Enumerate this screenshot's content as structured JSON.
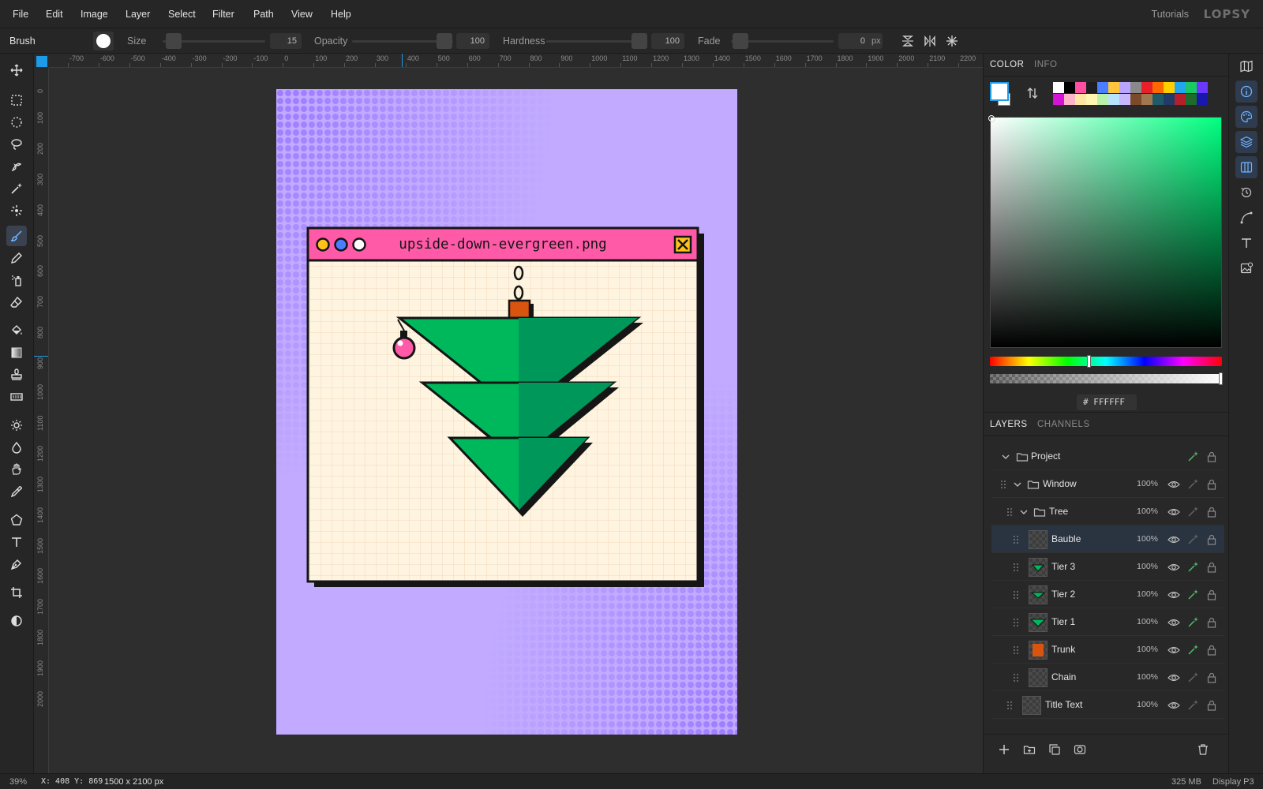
{
  "menu": [
    "File",
    "Edit",
    "Image",
    "Layer",
    "Select",
    "Filter",
    "Path",
    "View",
    "Help"
  ],
  "header_right": {
    "tutorials": "Tutorials",
    "logo": "LOPSY"
  },
  "options": {
    "tool_name": "Brush",
    "size_label": "Size",
    "size_value": "15",
    "opacity_label": "Opacity",
    "opacity_value": "100",
    "hardness_label": "Hardness",
    "hardness_value": "100",
    "fade_label": "Fade",
    "fade_value": "0",
    "fade_unit": "px"
  },
  "tools": [
    "move-tool",
    "rect-select-tool",
    "ellipse-select-tool",
    "lasso-tool",
    "quick-select-tool",
    "magic-wand-tool",
    "patch-tool",
    "brush-tool",
    "pencil-tool",
    "spray-tool",
    "eraser-tool",
    "fill-tool",
    "gradient-tool",
    "stamp-tool",
    "texture-tool",
    "dodge-tool",
    "blur-tool",
    "smudge-tool",
    "eyedropper-tool",
    "shape-tool",
    "text-tool",
    "pen-tool",
    "crop-tool",
    "contrast-tool"
  ],
  "ruler_top": [
    "-700",
    "-600",
    "-500",
    "-400",
    "-300",
    "-200",
    "-100",
    "0",
    "100",
    "200",
    "300",
    "400",
    "500",
    "600",
    "700",
    "800",
    "900",
    "1000",
    "1100",
    "1200",
    "1300",
    "1400",
    "1500",
    "1600",
    "1700",
    "1800",
    "1900",
    "2000",
    "2100",
    "2200"
  ],
  "ruler_left": [
    "0",
    "100",
    "200",
    "300",
    "400",
    "500",
    "600",
    "700",
    "800",
    "900",
    "1000",
    "1100",
    "1200",
    "1300",
    "1400",
    "1500",
    "1600",
    "1700",
    "1800",
    "1900",
    "2000"
  ],
  "canvas_window": {
    "filename": "upside-down-evergreen.png"
  },
  "panel": {
    "color_tab": "COLOR",
    "info_tab": "INFO",
    "hex_prefix": "#",
    "hex_value": "FFFFFF",
    "swatches_row1": [
      "#ffffff",
      "#000000",
      "#ff4fa3",
      "#1e1e1e",
      "#4a7dff",
      "#ffc53d",
      "#b9a4ff",
      "#8a8a8a",
      "#e8202a",
      "#ff6a00",
      "#ffcf00",
      "#23a6f0",
      "#18c964",
      "#6a38ff"
    ],
    "swatches_row2": [
      "#d414d4",
      "#ffb3c8",
      "#ffe7a3",
      "#fff6b0",
      "#b7f2a8",
      "#b7e3ff",
      "#c7b7ff",
      "#7a4a2a",
      "#a07850",
      "#1f5a66",
      "#233a66",
      "#b3202a",
      "#1f6b2a",
      "#1818b0"
    ],
    "layers_tab": "LAYERS",
    "channels_tab": "CHANNELS",
    "layers": [
      {
        "name": "Project",
        "opacity": ""
      },
      {
        "name": "Window",
        "opacity": "100%"
      },
      {
        "name": "Tree",
        "opacity": "100%"
      },
      {
        "name": "Bauble",
        "opacity": "100%"
      },
      {
        "name": "Tier 3",
        "opacity": "100%"
      },
      {
        "name": "Tier 2",
        "opacity": "100%"
      },
      {
        "name": "Tier 1",
        "opacity": "100%"
      },
      {
        "name": "Trunk",
        "opacity": "100%"
      },
      {
        "name": "Chain",
        "opacity": "100%"
      },
      {
        "name": "Title Text",
        "opacity": "100%"
      }
    ]
  },
  "status": {
    "zoom": "39%",
    "coords": "X: 408 Y: 869",
    "doc_size": "1500 x 2100 px",
    "memory": "325 MB",
    "color_profile": "Display P3"
  },
  "colors": {
    "accent": "#1e9be6",
    "artboard": "#c1aaff",
    "window_title": "#ff5aa8",
    "tree": "#00b85c",
    "trunk": "#d9540f"
  }
}
